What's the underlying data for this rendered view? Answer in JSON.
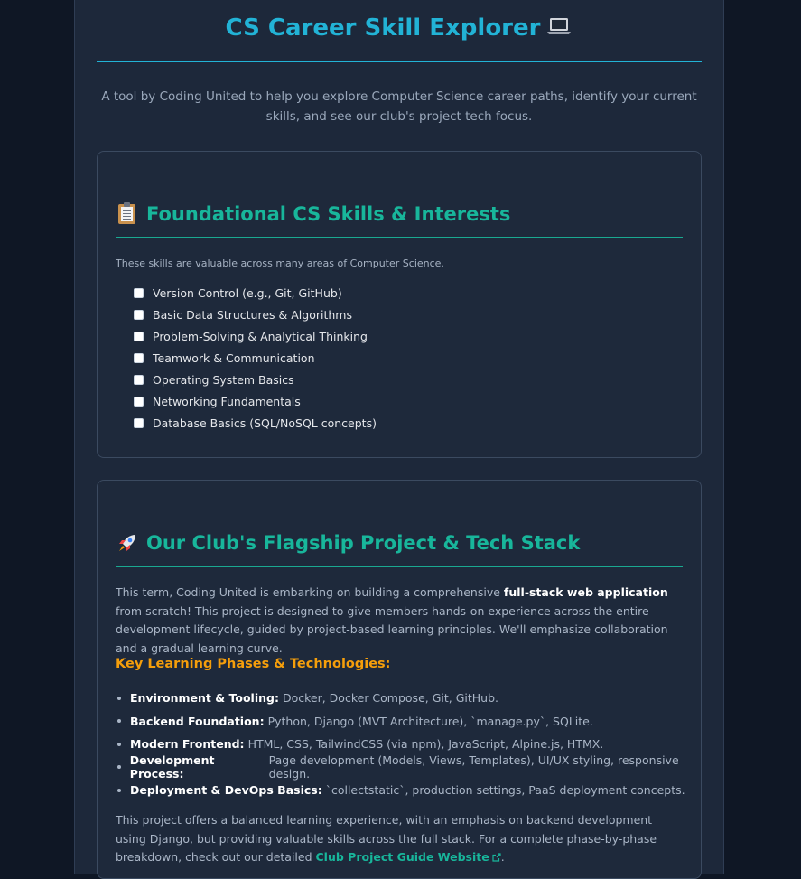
{
  "header": {
    "title": "CS Career Skill Explorer",
    "title_icon": "laptop-icon",
    "intro": "A tool by Coding United to help you explore Computer Science career paths, identify your current skills, and see our club's project tech focus."
  },
  "skills_section": {
    "icon": "clipboard-icon",
    "heading": "Foundational CS Skills & Interests",
    "note": "These skills are valuable across many areas of Computer Science.",
    "skills": [
      {
        "label": "Version Control (e.g., Git, GitHub)",
        "checked": false
      },
      {
        "label": "Basic Data Structures & Algorithms",
        "checked": false
      },
      {
        "label": "Problem-Solving & Analytical Thinking",
        "checked": false
      },
      {
        "label": "Teamwork & Communication",
        "checked": false
      },
      {
        "label": "Operating System Basics",
        "checked": false
      },
      {
        "label": "Networking Fundamentals",
        "checked": false
      },
      {
        "label": "Database Basics (SQL/NoSQL concepts)",
        "checked": false
      }
    ]
  },
  "project_section": {
    "icon": "rocket-icon",
    "heading": "Our Club's Flagship Project & Tech Stack",
    "p1_before": "This term, Coding United is embarking on building a comprehensive ",
    "p1_bold": "full-stack web application",
    "p1_after": " from scratch! This project is designed to give members hands-on experience across the entire development lifecycle, guided by project-based learning principles. We'll emphasize collaboration and a gradual learning curve.",
    "subheading": "Key Learning Phases & Technologies:",
    "phases": [
      {
        "label": "Environment & Tooling:",
        "text": "Docker, Docker Compose, Git, GitHub."
      },
      {
        "label": "Backend Foundation:",
        "text": "Python, Django (MVT Architecture), `manage.py`, SQLite."
      },
      {
        "label": "Modern Frontend:",
        "text": "HTML, CSS, TailwindCSS (via npm), JavaScript, Alpine.js, HTMX."
      },
      {
        "label": "Development Process:",
        "text": "Page development (Models, Views, Templates), UI/UX styling, responsive design."
      },
      {
        "label": "Deployment & DevOps Basics:",
        "text": "`collectstatic`, production settings, PaaS deployment concepts."
      }
    ],
    "p2_before": "This project offers a balanced learning experience, with an emphasis on backend development using Django, but providing valuable skills across the full stack. For a complete phase-by-phase breakdown, check out our detailed ",
    "p2_link": "Club Project Guide Website",
    "p2_after": "."
  },
  "colors": {
    "title": "#22b3d6",
    "section_heading": "#18b69b",
    "subheading": "#f59e0b",
    "background": "#0f1725",
    "panel": "#1d283a"
  }
}
